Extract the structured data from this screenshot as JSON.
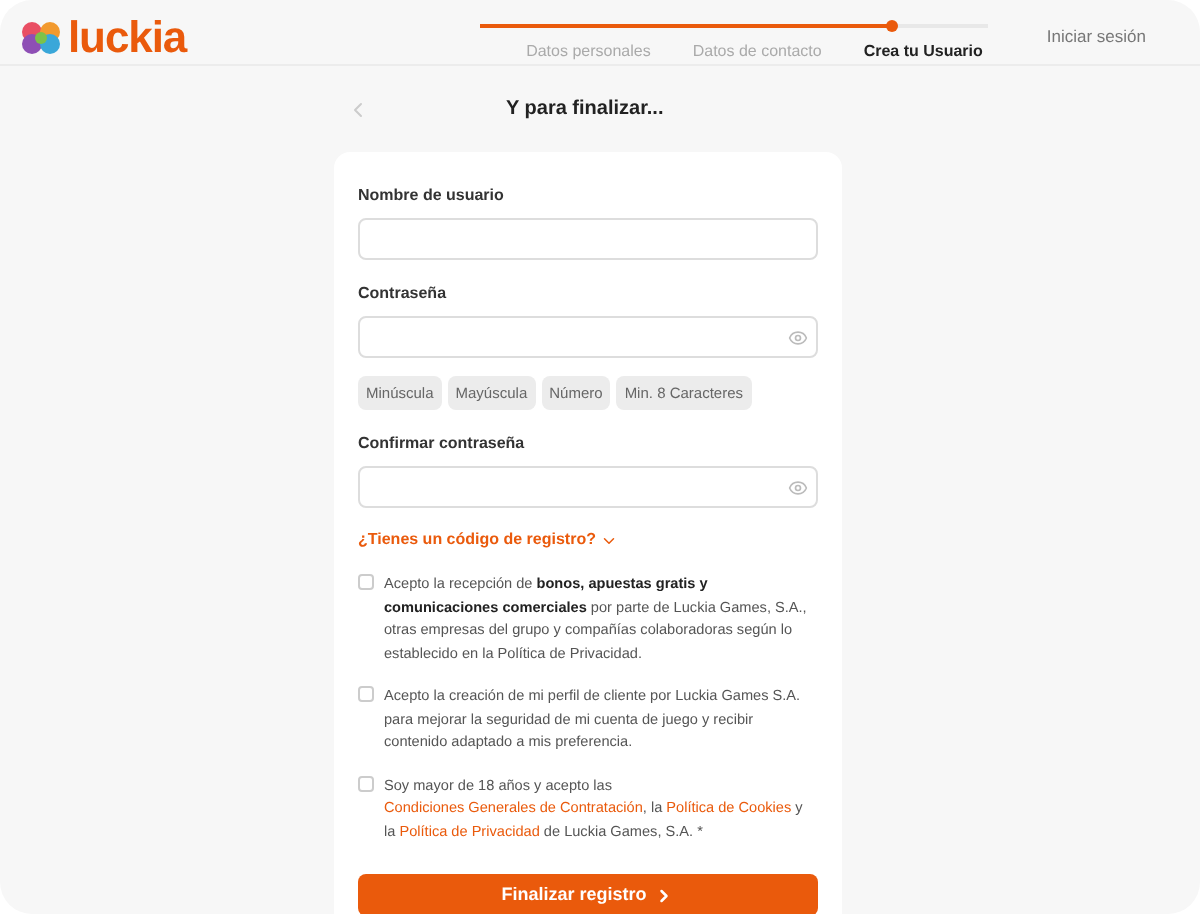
{
  "logo": {
    "text": "luckia"
  },
  "progress": {
    "level": 0.81
  },
  "steps": [
    {
      "label": "Datos personales",
      "selected": false
    },
    {
      "label": "Datos de contacto",
      "selected": false
    },
    {
      "label": "Crea tu Usuario",
      "selected": true
    }
  ],
  "login_link": "Iniciar sesión",
  "title": "Y para finalizar...",
  "fields": [
    {
      "label": "Nombre de usuario",
      "kind": "text"
    },
    {
      "label": "Contraseña",
      "kind": "password",
      "rules": [
        "Minúscula",
        "Mayúscula",
        "Número",
        "Min. 8 Caracteres"
      ]
    },
    {
      "label": "Confirmar contraseña",
      "kind": "password"
    }
  ],
  "code_link": "¿Tienes un código de registro?",
  "consents": [
    {
      "checked": false,
      "parts": [
        {
          "kind": "text",
          "text": "Acepto la recepción de **bonos, apuestas gratis y comunicaciones comerciales** por parte de Luckia Games, S.A., otras empresas del grupo y compañías colaboradoras según lo establecido en la Política de Privacidad."
        }
      ]
    },
    {
      "checked": false,
      "parts": [
        {
          "kind": "text",
          "text": "Acepto la creación de mi perfil de cliente por Luckia Games S.A. para mejorar la seguridad de mi cuenta de juego y recibir contenido adaptado a mis preferencia."
        }
      ]
    },
    {
      "checked": false,
      "parts": [
        {
          "kind": "text",
          "text": "Soy mayor de 18 años y acepto las"
        },
        {
          "kind": "link",
          "text": "Condiciones Generales de Contratación"
        },
        {
          "kind": "text",
          "text": ", la"
        },
        {
          "kind": "link",
          "text": "Política de Cookies"
        },
        {
          "kind": "text",
          "text": "y la"
        },
        {
          "kind": "link",
          "text": "Política de Privacidad"
        },
        {
          "kind": "text",
          "text": "de Luckia Games, S.A. *"
        }
      ]
    }
  ],
  "submit": "Finalizar registro"
}
